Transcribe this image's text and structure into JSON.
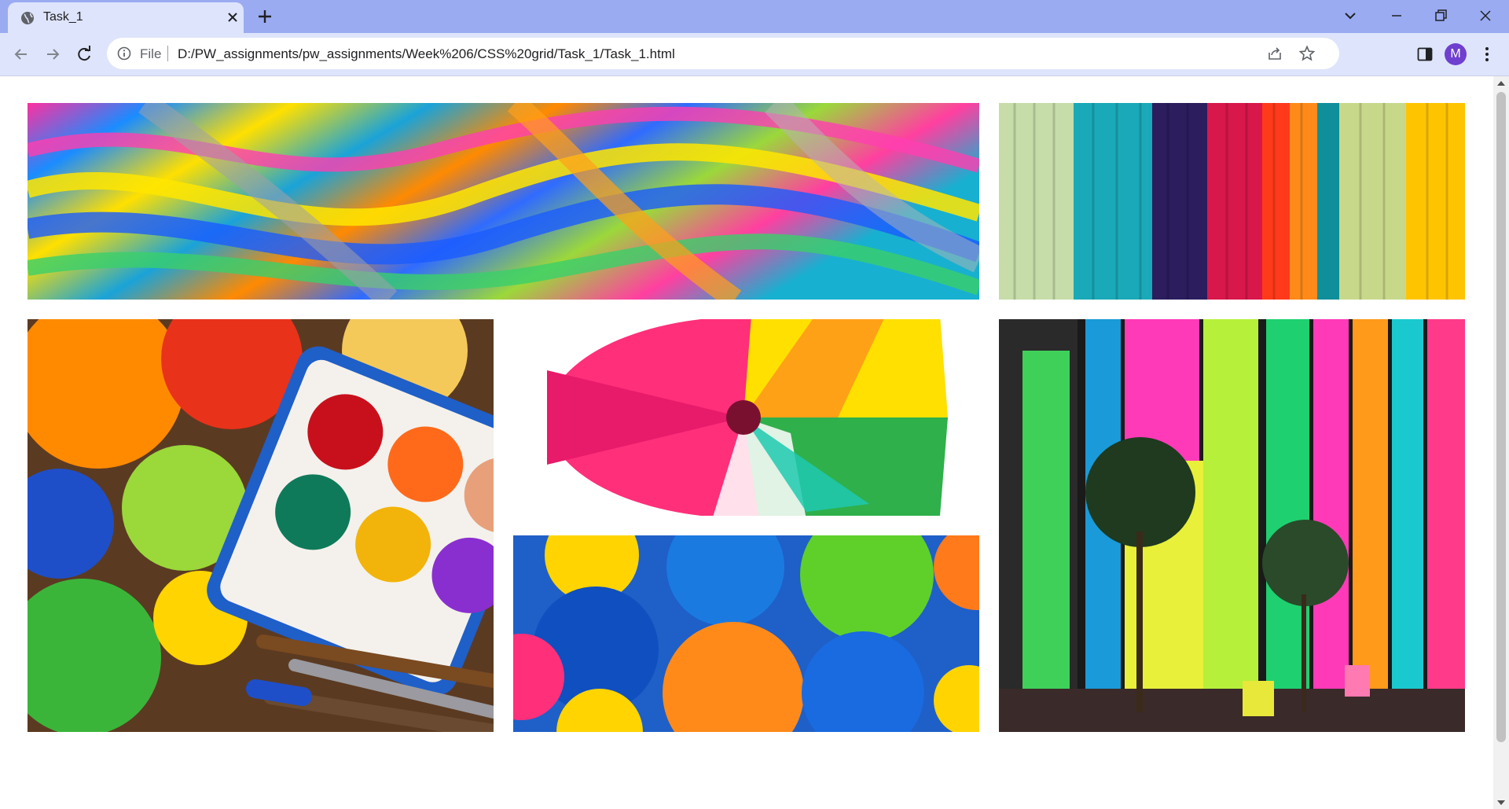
{
  "browser": {
    "tab_title": "Task_1",
    "omnibox_label": "File",
    "url": "D:/PW_assignments/pw_assignments/Week%206/CSS%20grid/Task_1/Task_1.html",
    "profile_initial": "M"
  },
  "gallery": {
    "images": [
      "marbled-paint-image",
      "striped-wall-image",
      "paint-palette-image",
      "rainbow-flower-image",
      "umbrellas-image",
      "colored-glass-building-image"
    ]
  },
  "colors": {
    "tabbar": "#9aabf2",
    "toolbar": "#dee4fb",
    "avatar": "#6f3fcf"
  }
}
